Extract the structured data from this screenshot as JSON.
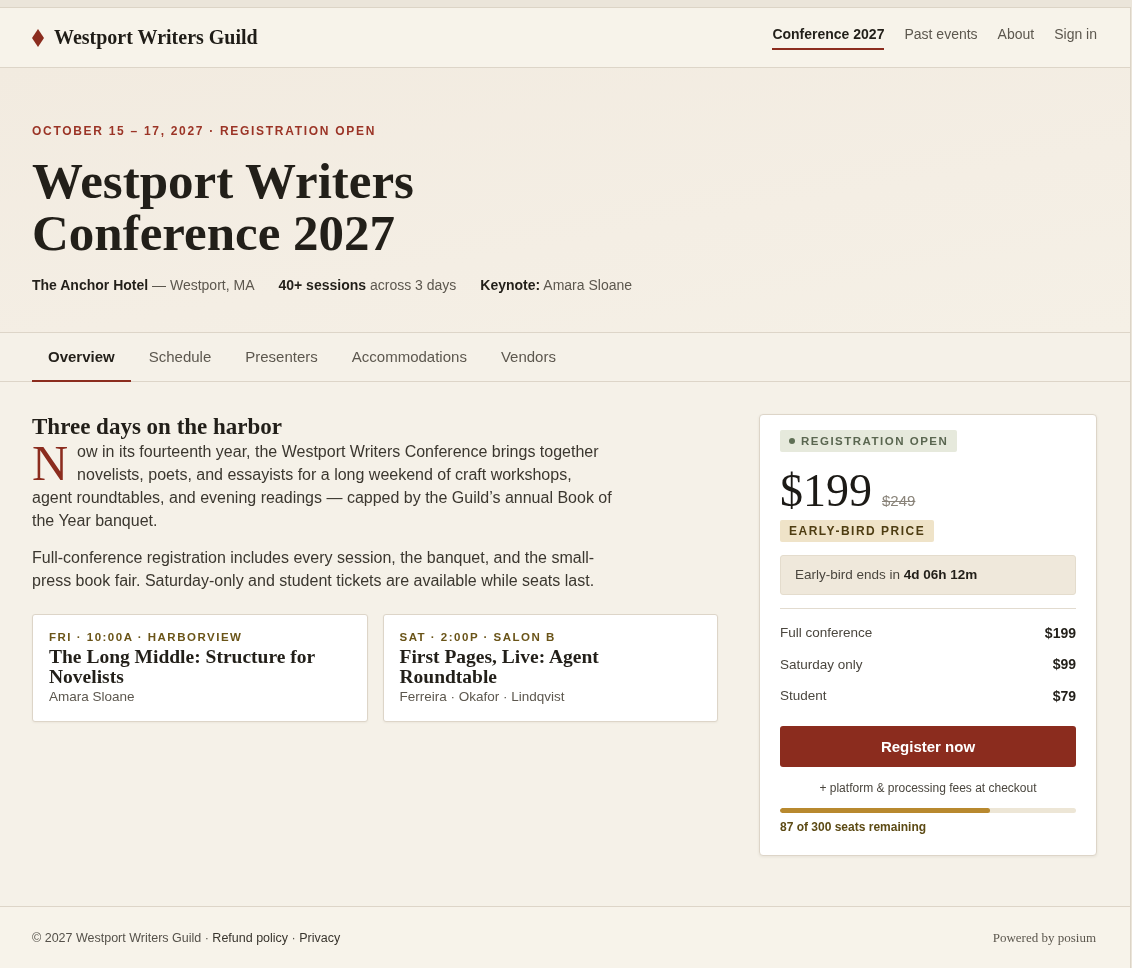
{
  "nav": {
    "brand": "Westport Writers Guild",
    "links": [
      {
        "label": "Conference 2027",
        "selected": true
      },
      {
        "label": "Past events",
        "selected": false
      },
      {
        "label": "About",
        "selected": false
      },
      {
        "label": "Sign in",
        "selected": false
      }
    ]
  },
  "hero": {
    "eyebrow": "OCTOBER 15 – 17, 2027 · REGISTRATION OPEN",
    "title": "Westport Writers Conference 2027",
    "facts": [
      "**The Anchor Hotel** — Westport, MA",
      "**40+ sessions** across 3 days",
      "**Keynote:** Amara Sloane"
    ]
  },
  "tabs": [
    {
      "label": "Overview",
      "selected": true
    },
    {
      "label": "Schedule",
      "selected": false
    },
    {
      "label": "Presenters",
      "selected": false
    },
    {
      "label": "Accommodations",
      "selected": false
    },
    {
      "label": "Vendors",
      "selected": false
    }
  ],
  "overview": {
    "heading": "Three days on the harbor",
    "intro": "Now in its fourteenth year, the Westport Writers Conference brings together novelists, poets, and essayists for a long weekend of craft workshops, agent roundtables, and evening readings — capped by the Guild’s annual Book of the Year banquet.",
    "body": "Full-conference registration includes every session, the banquet, and the small-press book fair. Saturday-only and student tickets are available while seats last."
  },
  "sessions": [
    {
      "when": "FRI · 10:00A · HARBORVIEW",
      "title": "The Long Middle: Structure for Novelists",
      "speakers": "Amara Sloane"
    },
    {
      "when": "SAT · 2:00P · SALON B",
      "title": "First Pages, Live: Agent Roundtable",
      "speakers": "Ferreira · Okafor · Lindqvist"
    }
  ],
  "registration": {
    "status": "REGISTRATION OPEN",
    "price": "$199",
    "old_price": "$249",
    "price_tag": "EARLY-BIRD PRICE",
    "countdown": "Early-bird ends in **4d 06h 12m**",
    "tickets": [
      {
        "name": "Full conference",
        "price": "$199"
      },
      {
        "name": "Saturday only",
        "price": "$99"
      },
      {
        "name": "Student",
        "price": "$79"
      }
    ],
    "button": "Register now",
    "fees_note": "+ platform & processing fees at checkout",
    "seats": {
      "level": 0.71,
      "label": "87 of 300 seats remaining"
    }
  },
  "footer": {
    "parts": [
      {
        "kind": "text",
        "text": "© 2027 Westport Writers Guild ·"
      },
      {
        "kind": "link",
        "text": "Refund policy"
      },
      {
        "kind": "text",
        "text": "·"
      },
      {
        "kind": "link",
        "text": "Privacy"
      }
    ],
    "powered_by": "Powered by posium"
  }
}
